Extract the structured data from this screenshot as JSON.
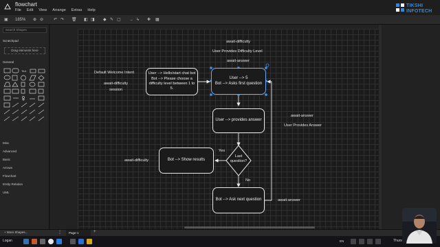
{
  "app": {
    "title": "flowchart",
    "menu": [
      "File",
      "Edit",
      "View",
      "Arrange",
      "Extras",
      "Help"
    ]
  },
  "logo": {
    "line1": "TIKSHI",
    "line2": "INFOTECH",
    "color": "#2f8ae6"
  },
  "toolbar": {
    "zoom": "185%"
  },
  "sidebar": {
    "search_placeholder": "Search Shapes",
    "scratchpad": "Scratchpad",
    "drag_hint": "Drag elements here",
    "general": "General",
    "categories": [
      "Misc",
      "Advanced",
      "Basic",
      "Arrows",
      "Flowchart",
      "Entity Relation",
      "UML"
    ],
    "more_shapes": "+ More Shapes..."
  },
  "tabs": {
    "page": "Page-1"
  },
  "diagram": {
    "nodes": {
      "intro": "User --> Hello/start chat bot\nBot --> Please choose a difficulty level between 1 to 5.",
      "ask_first": "User --> 5\nBot --> Asks first question",
      "provides_answer": "User --> provides answer",
      "decision": "Last question?",
      "show_results": "Bot --> Show results",
      "ask_next": "Bot --> Ask next question"
    },
    "labels": {
      "default_intent": "Default Welcome Intent",
      "await_difficulty_session": "await-difficulty\nsession",
      "await_difficulty_top": "await-difficulty",
      "user_provides_difficulty": "User Provides Difficulty Level",
      "await_answer_top": "await-answer",
      "await_answer_right": "await-answer",
      "user_provides_answer": "User Provides Answer",
      "yes": "Yes",
      "no": "No",
      "await_difficulty_left": "await-difficulty",
      "await_answer_bottom": "await-answer"
    }
  },
  "taskbar": {
    "user": "Logan",
    "lang": "EN",
    "time": "Thursday"
  }
}
